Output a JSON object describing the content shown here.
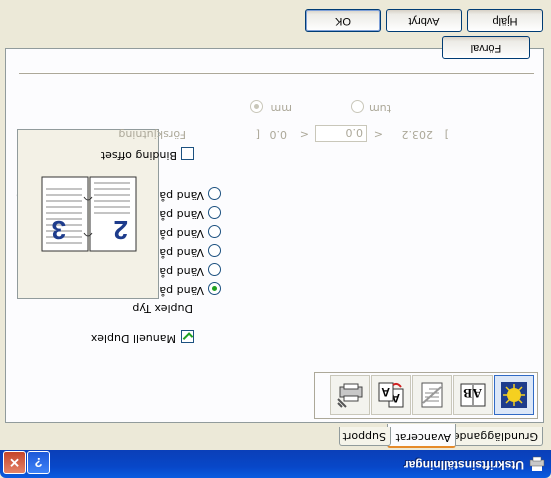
{
  "window": {
    "title": "Utskriftsinställningar",
    "help_glyph": "?",
    "close_glyph": "✕"
  },
  "tabs": [
    {
      "label": "Grundläggande"
    },
    {
      "label": "Avancerat",
      "active": true
    },
    {
      "label": "Support"
    }
  ],
  "icons": [
    {
      "name": "watermark-icon",
      "selected": true
    },
    {
      "name": "ab-scaling-icon"
    },
    {
      "name": "copy-icon"
    },
    {
      "name": "duplex-icon"
    },
    {
      "name": "device-options-icon"
    }
  ],
  "duplex": {
    "manual_duplex_label": "Manuell Duplex",
    "manual_duplex_checked": true,
    "type_label": "Duplex Typ",
    "options": [
      {
        "label": "Vänd på vänster kant",
        "selected": true
      },
      {
        "label": "Vänd på höger kant",
        "selected": false
      },
      {
        "label": "Vänd på övre kant",
        "selected": false
      },
      {
        "label": "Vänd på nedre kant",
        "selected": false
      },
      {
        "label": "Vänd på övre kant (Tom baksida)",
        "selected": false
      },
      {
        "label": "Vänd på nedre kant (Tom baksida)",
        "selected": false
      }
    ],
    "preview_numbers": [
      "2",
      "3"
    ],
    "binding_offset_label": "Binding offset",
    "binding_offset_checked": false,
    "forskjutning_label": "Förskjutning",
    "range_open": "[",
    "range_min": "0.0",
    "range_lt": "<",
    "value": "0.0",
    "range_lt2": "<",
    "range_max": "203.2",
    "range_close": "]",
    "unit_options": [
      {
        "label": "mm",
        "selected": true
      },
      {
        "label": "tum",
        "selected": false
      }
    ]
  },
  "buttons": {
    "default_label": "Förval",
    "ok_label": "OK",
    "cancel_label": "Avbryt",
    "help_label": "Hjälp"
  }
}
